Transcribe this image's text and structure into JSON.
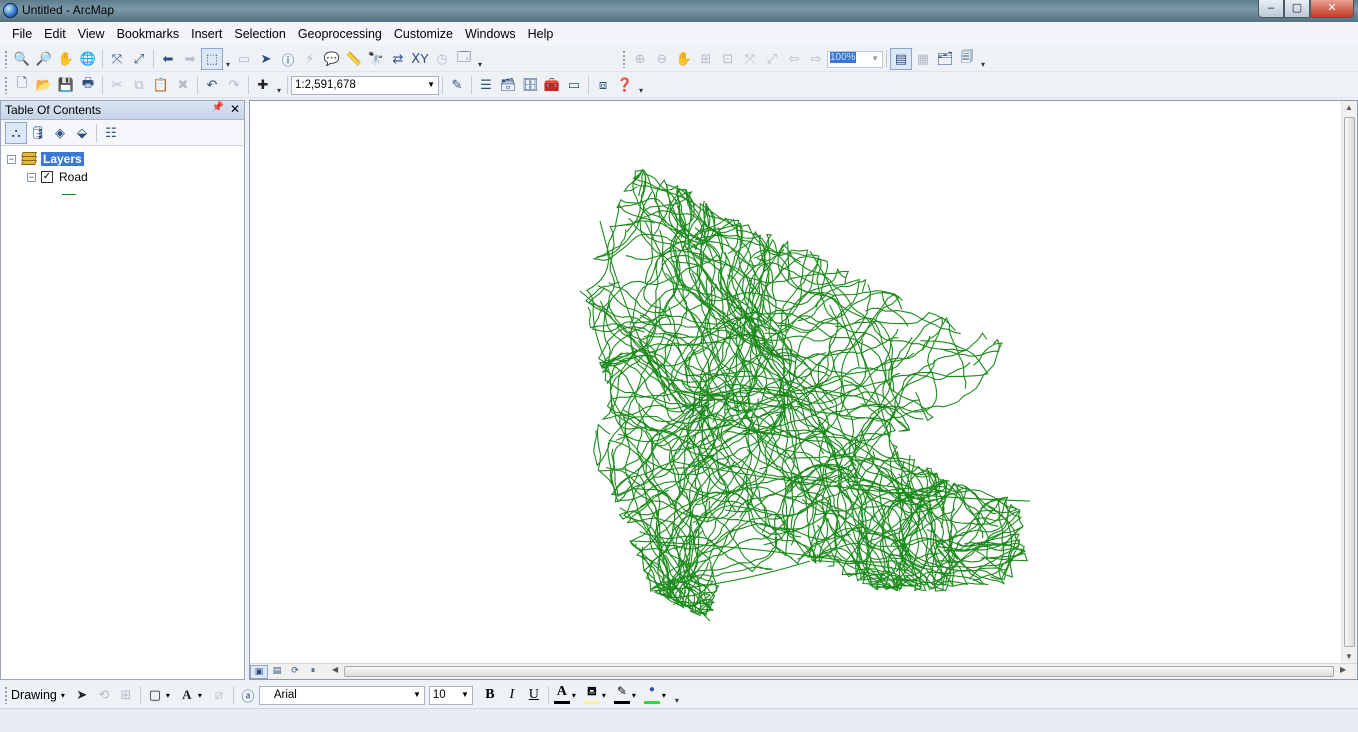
{
  "window": {
    "title": "Untitled - ArcMap",
    "minimize": "–",
    "maximize": "▢",
    "close": "✕"
  },
  "menu": [
    "File",
    "Edit",
    "View",
    "Bookmarks",
    "Insert",
    "Selection",
    "Geoprocessing",
    "Customize",
    "Windows",
    "Help"
  ],
  "standard_toolbar": {
    "scale": "1:2,591,678"
  },
  "layout_toolbar": {
    "zoom_percent": "100%"
  },
  "toc": {
    "title": "Table Of Contents",
    "pin": "📌",
    "close": "✕",
    "root_label": "Layers",
    "layer_label": "Road",
    "layer_checked": "✓",
    "expander_collapse": "−"
  },
  "drawing_toolbar": {
    "label": "Drawing",
    "font_name": "Arial",
    "font_size": "10",
    "bold": "B",
    "italic": "I",
    "underline": "U",
    "font_color_glyph": "A",
    "colors": {
      "font": "#000000",
      "fill": "#f4f4a0",
      "line": "#000000",
      "marker": "#3cd23c"
    }
  },
  "colors": {
    "road": "#1c8a1c",
    "selection": "#3a78d6"
  }
}
